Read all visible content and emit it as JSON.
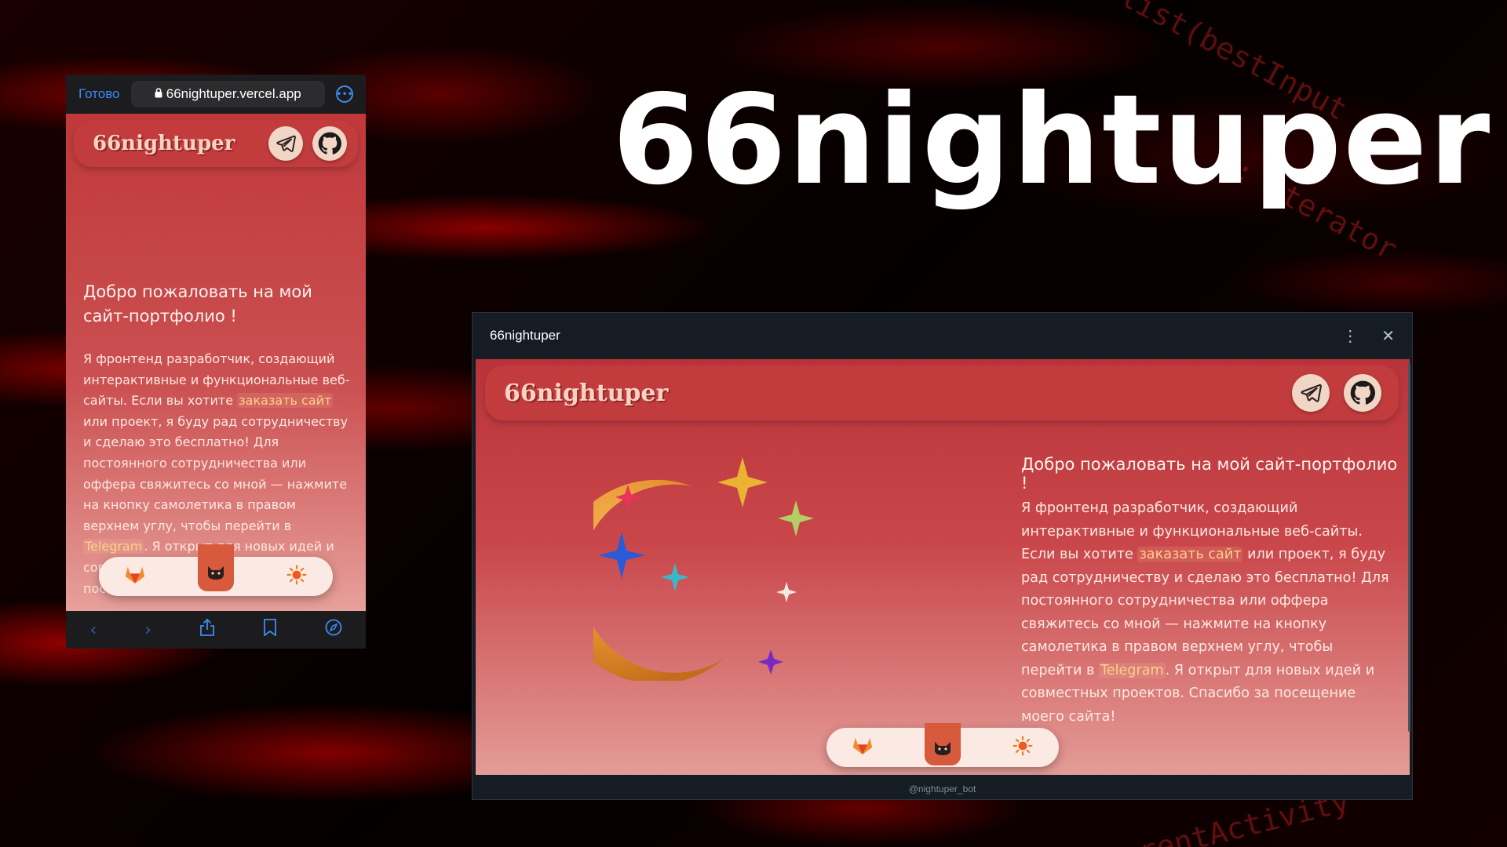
{
  "hero": {
    "title": "66nightuper"
  },
  "phone": {
    "done_label": "Готово",
    "url": "66nightuper.vercel.app",
    "logo": "66nightuper",
    "welcome": "Добро пожаловать на мой сайт-портфолио !",
    "body_1": "Я фронтенд разработчик, создающий интерактивные и функциональные веб-сайты. Если вы хотите ",
    "link_order": "заказать сайт",
    "body_2": " или проект, я буду рад сотрудничеству и сделаю это бесплатно! Для постоянного сотрудничества или оффера свяжитесь со мной — нажмите на кнопку самолетика в правом верхнем углу, чтобы перейти в ",
    "link_telegram": "Telegram",
    "body_3": ". Я открыт для новых идей и совместных проектов. Спасибо за посещение моего сайта!"
  },
  "window": {
    "title": "66nightuper",
    "logo": "66nightuper",
    "welcome": "Добро пожаловать на мой сайт-портфолио !",
    "body_1": "Я фронтенд разработчик, создающий интерактивные и функциональные веб-сайты. Если вы хотите ",
    "link_order": "заказать сайт",
    "body_2": " или проект, я буду рад сотрудничеству и сделаю это бесплатно! Для постоянного сотрудничества или оффера свяжитесь со мной — нажмите на кнопку самолетика в правом верхнем углу, чтобы перейти в ",
    "link_telegram": "Telegram",
    "body_3": ". Я открыт для новых идей и совместных проектов. Спасибо за посещение моего сайта!",
    "footer": "@nightuper_bot"
  },
  "icons": {
    "telegram": "telegram-icon",
    "github": "github-icon",
    "gitlab": "gitlab-icon",
    "cat": "cat-icon",
    "theme": "sun-icon"
  },
  "colors": {
    "accent_red": "#c23c3d",
    "header_cream": "#f1d6c5",
    "link_yellow": "#ffd08a",
    "moon_gold": "#e59a35"
  }
}
